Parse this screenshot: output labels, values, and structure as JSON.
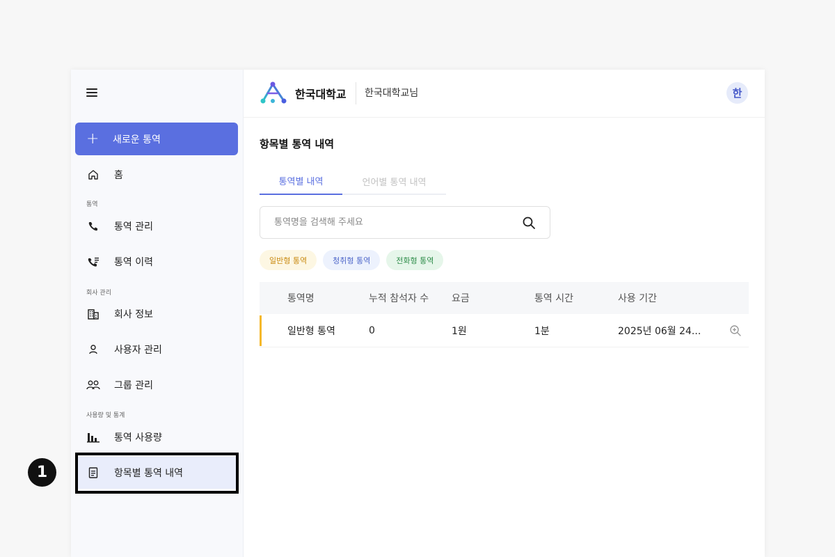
{
  "sidebar": {
    "menu_icon": "hamburger-icon",
    "new_button": {
      "icon": "plus-icon",
      "label": "새로운 통역"
    },
    "home": {
      "icon": "home-icon",
      "label": "홈"
    },
    "section_interpret": "통역",
    "interpret_manage": {
      "icon": "phone-icon",
      "label": "통역 관리"
    },
    "interpret_history": {
      "icon": "call-log-icon",
      "label": "통역 이력"
    },
    "section_company": "회사 관리",
    "company_info": {
      "icon": "building-icon",
      "label": "회사 정보"
    },
    "user_manage": {
      "icon": "user-icon",
      "label": "사용자 관리"
    },
    "group_manage": {
      "icon": "group-icon",
      "label": "그룹 관리"
    },
    "section_stats": "사용량 및 통계",
    "usage": {
      "icon": "bar-chart-icon",
      "label": "통역 사용량"
    },
    "item_history": {
      "icon": "document-icon",
      "label": "항목별 통역 내역"
    }
  },
  "step_badge": "1",
  "header": {
    "brand": "한국대학교",
    "user": "한국대학교님",
    "avatar": "한"
  },
  "page": {
    "title": "항목별 통역 내역",
    "tabs": [
      "통역별 내역",
      "언어별 통역 내역"
    ],
    "search_placeholder": "통역명을 검색해 주세요",
    "chips": [
      "일반형 통역",
      "청취형 통역",
      "전화형 통역"
    ]
  },
  "table": {
    "headers": [
      "통역명",
      "누적 참석자 수",
      "요금",
      "통역 시간",
      "사용 기간"
    ],
    "rows": [
      {
        "name": "일반형 통역",
        "participants": "0",
        "fee": "1원",
        "time": "1분",
        "period": "2025년 06월 24..."
      }
    ]
  },
  "colors": {
    "accent": "#5a6fe0",
    "row_bar": "#f5b82a",
    "chip_general": "#c98a10",
    "chip_listen": "#4d66c9",
    "chip_phone": "#2f8d4a"
  }
}
